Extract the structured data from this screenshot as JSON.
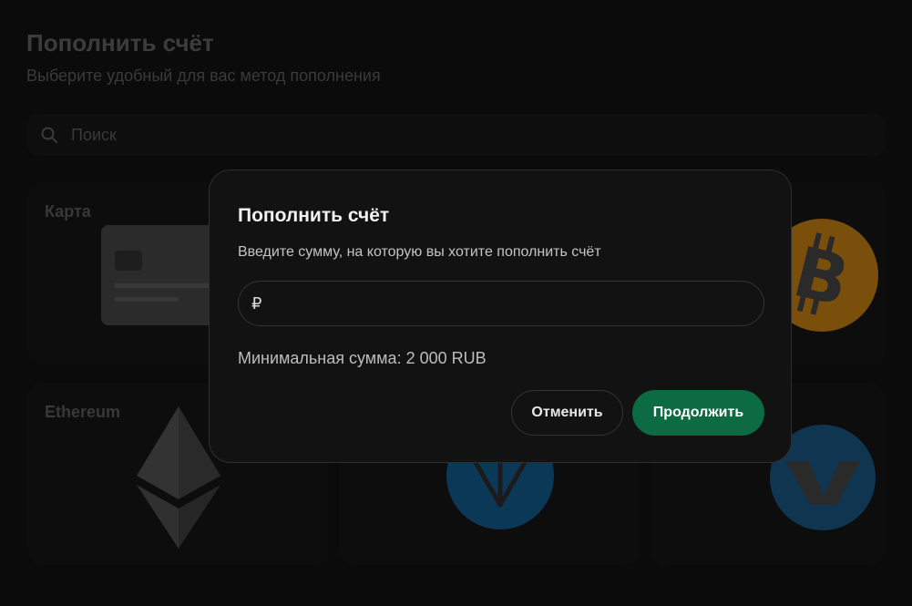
{
  "page": {
    "title": "Пополнить счёт",
    "subtitle": "Выберите удобный для вас метод пополнения"
  },
  "search": {
    "placeholder": "Поиск",
    "icon": "search-icon"
  },
  "methods": [
    {
      "label": "Карта",
      "icon": "bank-card-icon"
    },
    {
      "label": "",
      "icon": "unknown"
    },
    {
      "label": "",
      "icon": "bitcoin-icon"
    },
    {
      "label": "Ethereum",
      "icon": "ethereum-icon"
    },
    {
      "label": "",
      "icon": "toncoin-icon"
    },
    {
      "label": "",
      "icon": "v-coin-icon"
    }
  ],
  "dialog": {
    "title": "Пополнить счёт",
    "description": "Введите сумму, на которую вы хотите пополнить счёт",
    "currency_symbol": "₽",
    "amount_value": "",
    "min_note": "Минимальная сумма: 2 000 RUB",
    "cancel_label": "Отменить",
    "continue_label": "Продолжить"
  },
  "colors": {
    "accent": "#0c6b43",
    "bitcoin": "#8a5a0c",
    "toncoin": "#0b3c5e",
    "v_coin": "#113855"
  }
}
